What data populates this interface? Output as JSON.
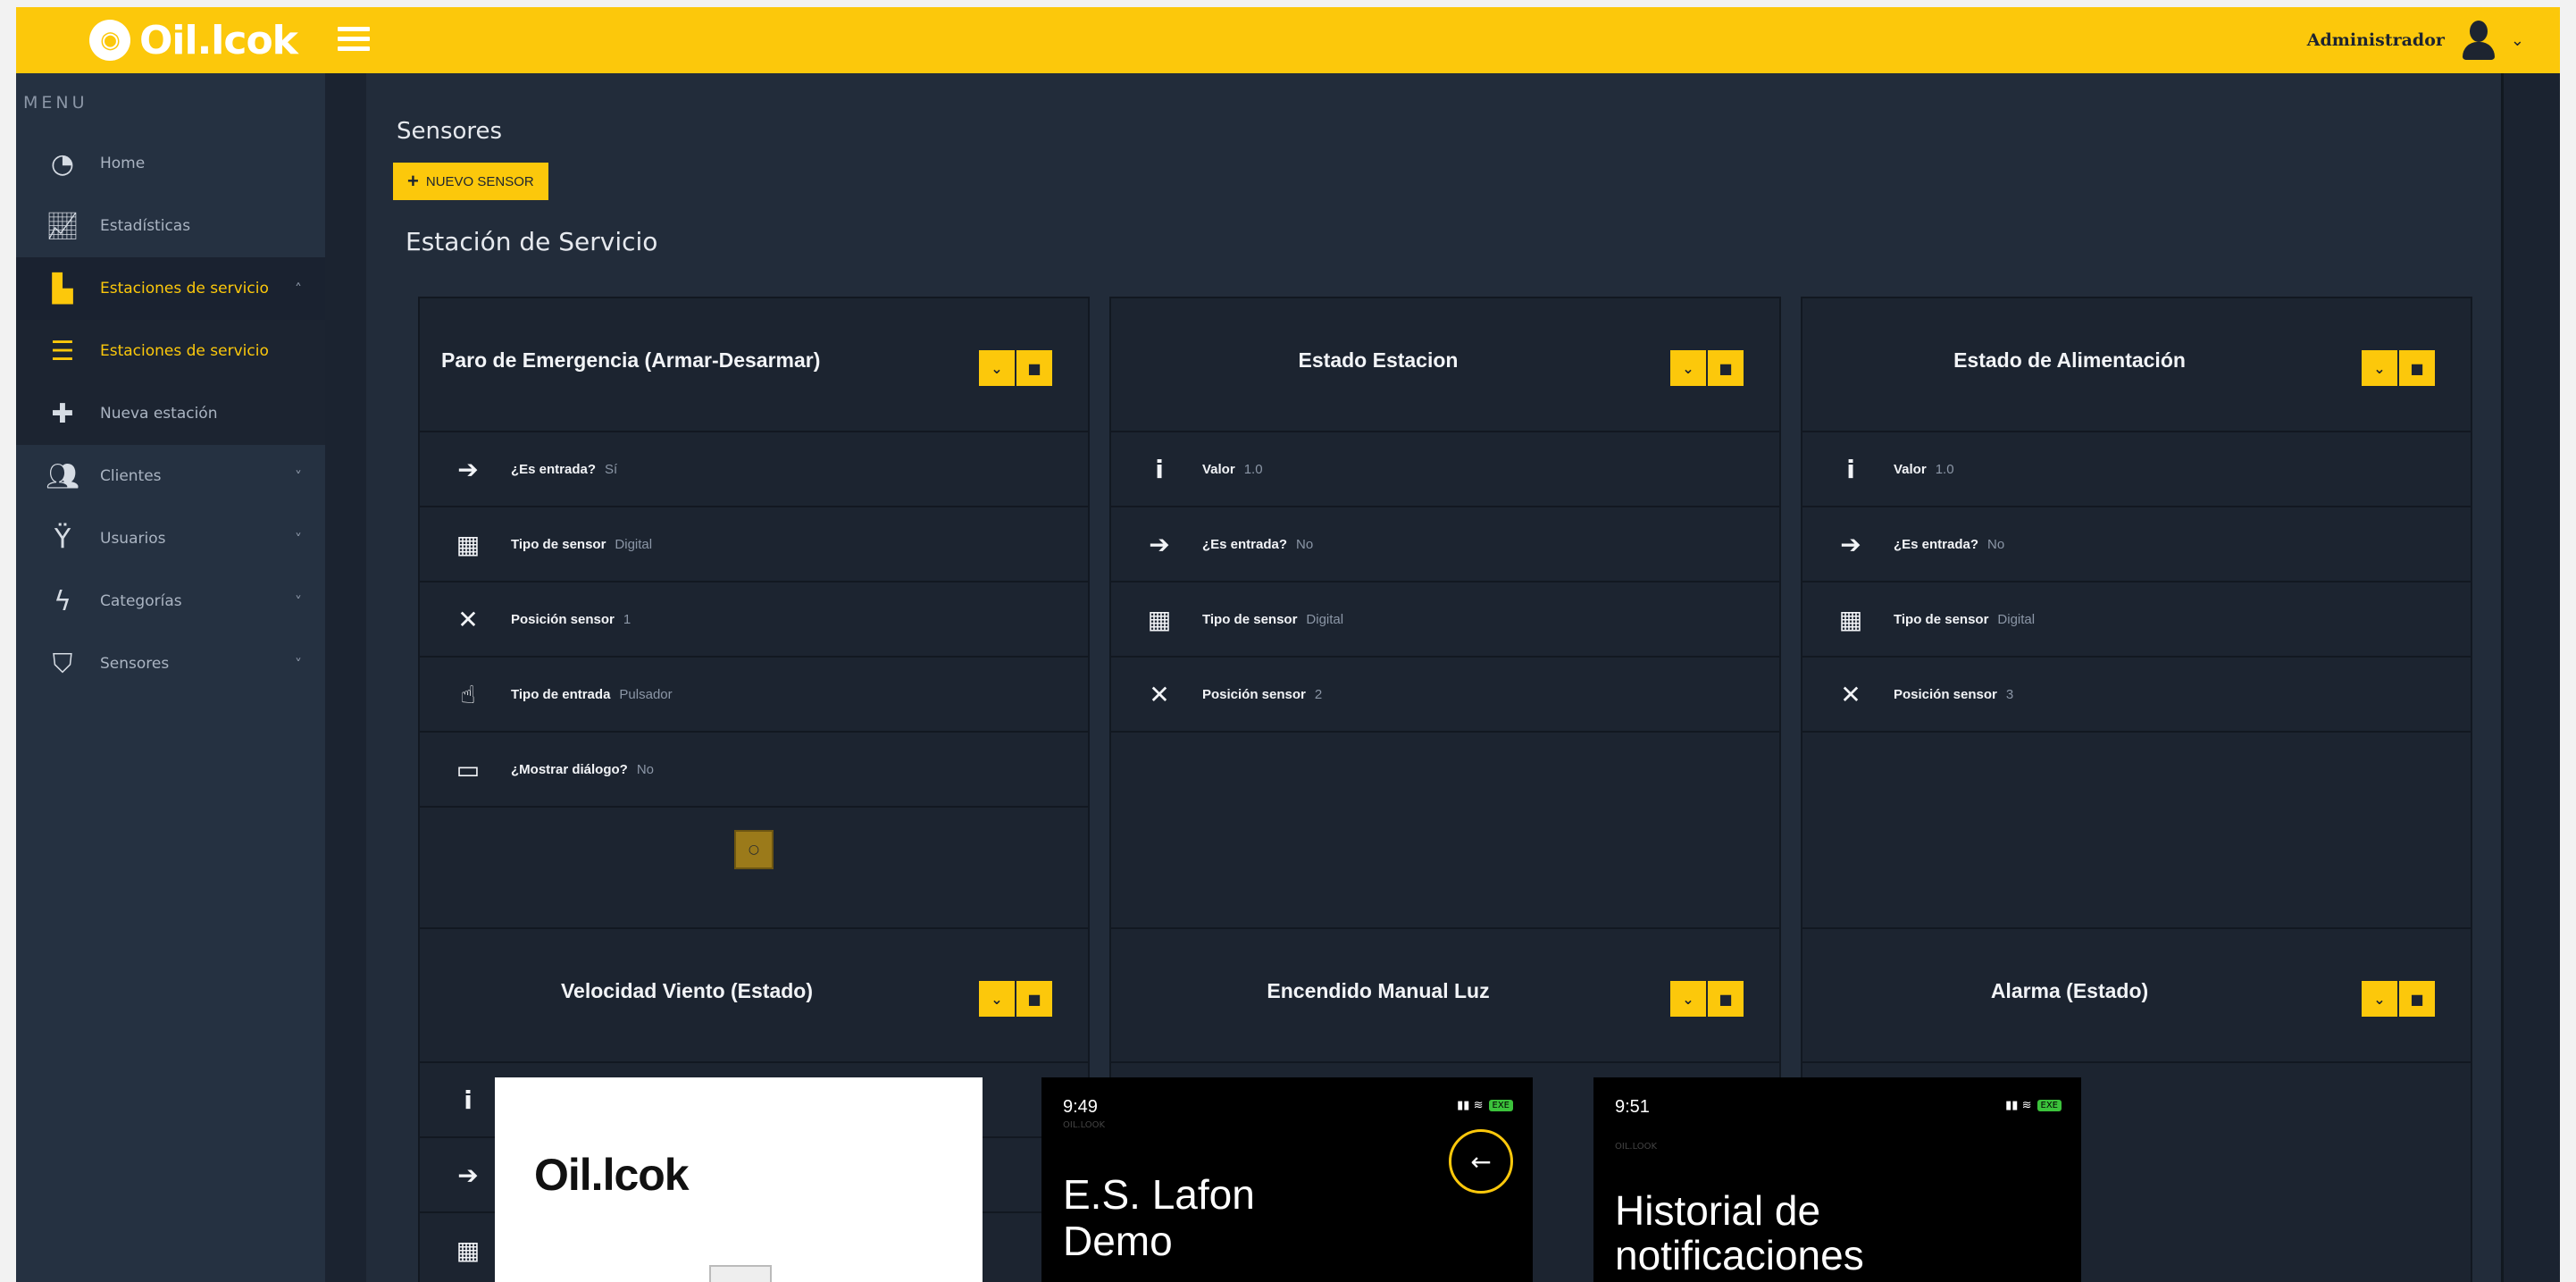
{
  "app": {
    "logo_text": "Oil.lcok",
    "user_name": "Administrador"
  },
  "sidebar": {
    "menu_title": "MENU",
    "items": [
      {
        "label": "Home",
        "icon": "dashboard-icon"
      },
      {
        "label": "Estadísticas",
        "icon": "chart-line-icon"
      },
      {
        "label": "Estaciones de servicio",
        "icon": "fuel-pump-icon",
        "active": true
      },
      {
        "label": "Estaciones de servicio",
        "icon": "list-icon",
        "sub": true,
        "active": true
      },
      {
        "label": "Nueva estación",
        "icon": "plus-icon",
        "sub": true
      },
      {
        "label": "Clientes",
        "icon": "users-icon"
      },
      {
        "label": "Usuarios",
        "icon": "user-icon"
      },
      {
        "label": "Categorías",
        "icon": "bolt-icon"
      },
      {
        "label": "Sensores",
        "icon": "shield-icon"
      }
    ]
  },
  "main": {
    "page_title": "Sensores",
    "new_button": "NUEVO SENSOR",
    "section_title": "Estación de Servicio",
    "cards": [
      {
        "title": "Paro de Emergencia (Armar-Desarmar)",
        "rows": [
          {
            "icon": "arrow-right-icon",
            "label": "¿Es entrada?",
            "value": "Sí"
          },
          {
            "icon": "grid-icon",
            "label": "Tipo de sensor",
            "value": "Digital"
          },
          {
            "icon": "expand-icon",
            "label": "Posición sensor",
            "value": "1"
          },
          {
            "icon": "hand-pointer-icon",
            "label": "Tipo de entrada",
            "value": "Pulsador"
          },
          {
            "icon": "window-icon",
            "label": "¿Mostrar diálogo?",
            "value": "No"
          }
        ]
      },
      {
        "title": "Estado Estacion",
        "rows": [
          {
            "icon": "info-icon",
            "label": "Valor",
            "value": "1.0"
          },
          {
            "icon": "arrow-right-icon",
            "label": "¿Es entrada?",
            "value": "No"
          },
          {
            "icon": "grid-icon",
            "label": "Tipo de sensor",
            "value": "Digital"
          },
          {
            "icon": "expand-icon",
            "label": "Posición sensor",
            "value": "2"
          }
        ]
      },
      {
        "title": "Estado de Alimentación",
        "rows": [
          {
            "icon": "info-icon",
            "label": "Valor",
            "value": "1.0"
          },
          {
            "icon": "arrow-right-icon",
            "label": "¿Es entrada?",
            "value": "No"
          },
          {
            "icon": "grid-icon",
            "label": "Tipo de sensor",
            "value": "Digital"
          },
          {
            "icon": "expand-icon",
            "label": "Posición sensor",
            "value": "3"
          }
        ]
      },
      {
        "title": "Velocidad Viento (Estado)"
      },
      {
        "title": "Encendido Manual Luz"
      },
      {
        "title": "Alarma (Estado)"
      }
    ]
  },
  "phones": [
    {
      "logo": "Oil.lcok"
    },
    {
      "time": "9:49",
      "brand": "OIL.LOOK",
      "heading_line1": "E.S. Lafon",
      "heading_line2": "Demo",
      "battery": "EXE"
    },
    {
      "time": "9:51",
      "brand": "OIL.LOOK",
      "heading_line1": "Historial de",
      "heading_line2": "notificaciones",
      "battery": "EXE"
    }
  ]
}
